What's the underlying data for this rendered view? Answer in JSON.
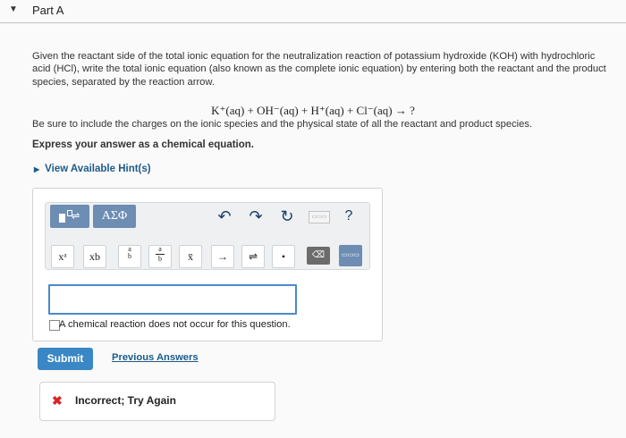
{
  "part": {
    "toggle_icon": "triangle-down-icon",
    "title": "Part A"
  },
  "question": {
    "text": "Given the reactant side of the total ionic equation for the neutralization reaction of potassium hydroxide (KOH) with hydrochloric acid (HCl), write the total ionic equation (also known as the complete ionic equation) by entering both the reactant and the product species, separated by the reaction arrow.",
    "equation": "K⁺(aq) + OH⁻(aq) + H⁺(aq) + Cl⁻(aq) → ?",
    "instruction": "Be sure to include the charges on the ionic species and the physical state of all the reactant and product species.",
    "express": "Express your answer as a chemical equation."
  },
  "hints": {
    "label": "View Available Hint(s)"
  },
  "editor": {
    "greek_label": "ΑΣΦ",
    "undo": "↶",
    "redo": "↷",
    "reset": "↻",
    "help": "?",
    "keyboard_label": "▭▭▭",
    "buttons": {
      "superscript": "xᵃ",
      "subscript": "xb",
      "frac_top": "a",
      "frac_bottom": "b",
      "xbar": "x̄",
      "arrow": "→",
      "eq_arrow": "⇌",
      "dot": "•",
      "clear": "⌫"
    },
    "input_value": "",
    "no_reaction_label": "A chemical reaction does not occur for this question."
  },
  "actions": {
    "submit_label": "Submit",
    "previous_label": "Previous Answers"
  },
  "feedback": {
    "icon": "x-icon",
    "mark": "✖",
    "text": "Incorrect; Try Again"
  },
  "colors": {
    "accent": "#3a87c5",
    "toolbar_btn": "#6d8db3",
    "error": "#d9242b",
    "link": "#1c5b8a"
  }
}
